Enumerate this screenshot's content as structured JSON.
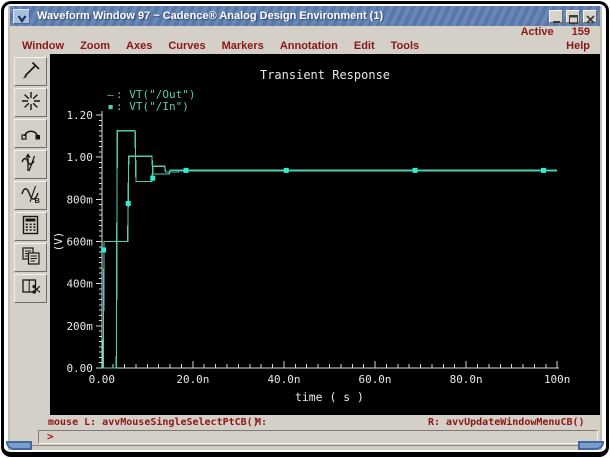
{
  "window": {
    "title": "Waveform Window 97 ~ Cadence® Analog Design Environment (1)",
    "menu_icon": "chevron-down-icon",
    "controls": [
      "minimize-icon",
      "maximize-icon",
      "close-icon"
    ],
    "active_label": "Active",
    "active_value": "159"
  },
  "menu": {
    "items": [
      "Window",
      "Zoom",
      "Axes",
      "Curves",
      "Markers",
      "Annotation",
      "Edit",
      "Tools"
    ],
    "help": "Help"
  },
  "toolbar": {
    "icons": [
      "pen-icon",
      "starburst-icon",
      "probe-arc-icon",
      "waveform-axis-icon",
      "sine-b-icon",
      "calculator-icon",
      "copy-window-icon",
      "cut-window-icon"
    ]
  },
  "chart_data": {
    "type": "line",
    "title": "Transient Response",
    "xlabel": "time ( s )",
    "ylabel": "(V)",
    "x_unit": "ns",
    "xlim": [
      0,
      100
    ],
    "ylim": [
      0,
      1.2
    ],
    "grid": false,
    "legend_position": "top-left",
    "background": "#000000",
    "axis_color": "#d8d8d8",
    "text_color": "#e8e8e8",
    "x_ticks": [
      {
        "v": 0,
        "label": "0.00"
      },
      {
        "v": 20,
        "label": "20.0n"
      },
      {
        "v": 40,
        "label": "40.0n"
      },
      {
        "v": 60,
        "label": "60.0n"
      },
      {
        "v": 80,
        "label": "80.0n"
      },
      {
        "v": 100,
        "label": "100n"
      }
    ],
    "y_ticks": [
      {
        "v": 0,
        "label": "0.00"
      },
      {
        "v": 0.2,
        "label": "200m"
      },
      {
        "v": 0.4,
        "label": "400m"
      },
      {
        "v": 0.6,
        "label": "600m"
      },
      {
        "v": 0.8,
        "label": "800m"
      },
      {
        "v": 1.0,
        "label": "1.00"
      },
      {
        "v": 1.2,
        "label": "1.20"
      }
    ],
    "x_minor_step": 2.5,
    "y_minor_step": 0.025,
    "series": [
      {
        "name": "VT(\"/Out\")",
        "legend_glyph": "–",
        "color": "#4ecdb0",
        "points": [
          [
            0,
            0
          ],
          [
            3.2,
            0
          ],
          [
            3.4,
            1.125
          ],
          [
            7.3,
            1.125
          ],
          [
            7.5,
            0.885
          ],
          [
            11.0,
            0.885
          ],
          [
            11.2,
            0.957
          ],
          [
            13.8,
            0.957
          ],
          [
            14.0,
            0.93
          ],
          [
            16.8,
            0.93
          ],
          [
            17.0,
            0.936
          ],
          [
            100,
            0.936
          ]
        ]
      },
      {
        "name": "VT(\"/In\")",
        "legend_glyph": "▪",
        "color": "#4ecdb0",
        "marker_color": "#35ecd2",
        "points": [
          [
            0.3,
            0
          ],
          [
            0.5,
            0.6
          ],
          [
            5.7,
            0.6
          ],
          [
            5.9,
            1.005
          ],
          [
            11.0,
            1.005
          ],
          [
            11.2,
            0.92
          ],
          [
            14.8,
            0.92
          ],
          [
            15.0,
            0.9375
          ],
          [
            100,
            0.9375
          ]
        ],
        "markers": [
          [
            0.4,
            0.56
          ],
          [
            5.8,
            0.78
          ],
          [
            11.2,
            0.9
          ],
          [
            18.5,
            0.937
          ],
          [
            40.5,
            0.937
          ],
          [
            68.8,
            0.937
          ],
          [
            97,
            0.937
          ]
        ]
      }
    ]
  },
  "status": {
    "mouse_label": "mouse L: avvMouseSingleSelectPtCB()",
    "middle_label": "M:",
    "right_label": "R: avvUpdateWindowMenuCB()",
    "prompt": ">"
  }
}
